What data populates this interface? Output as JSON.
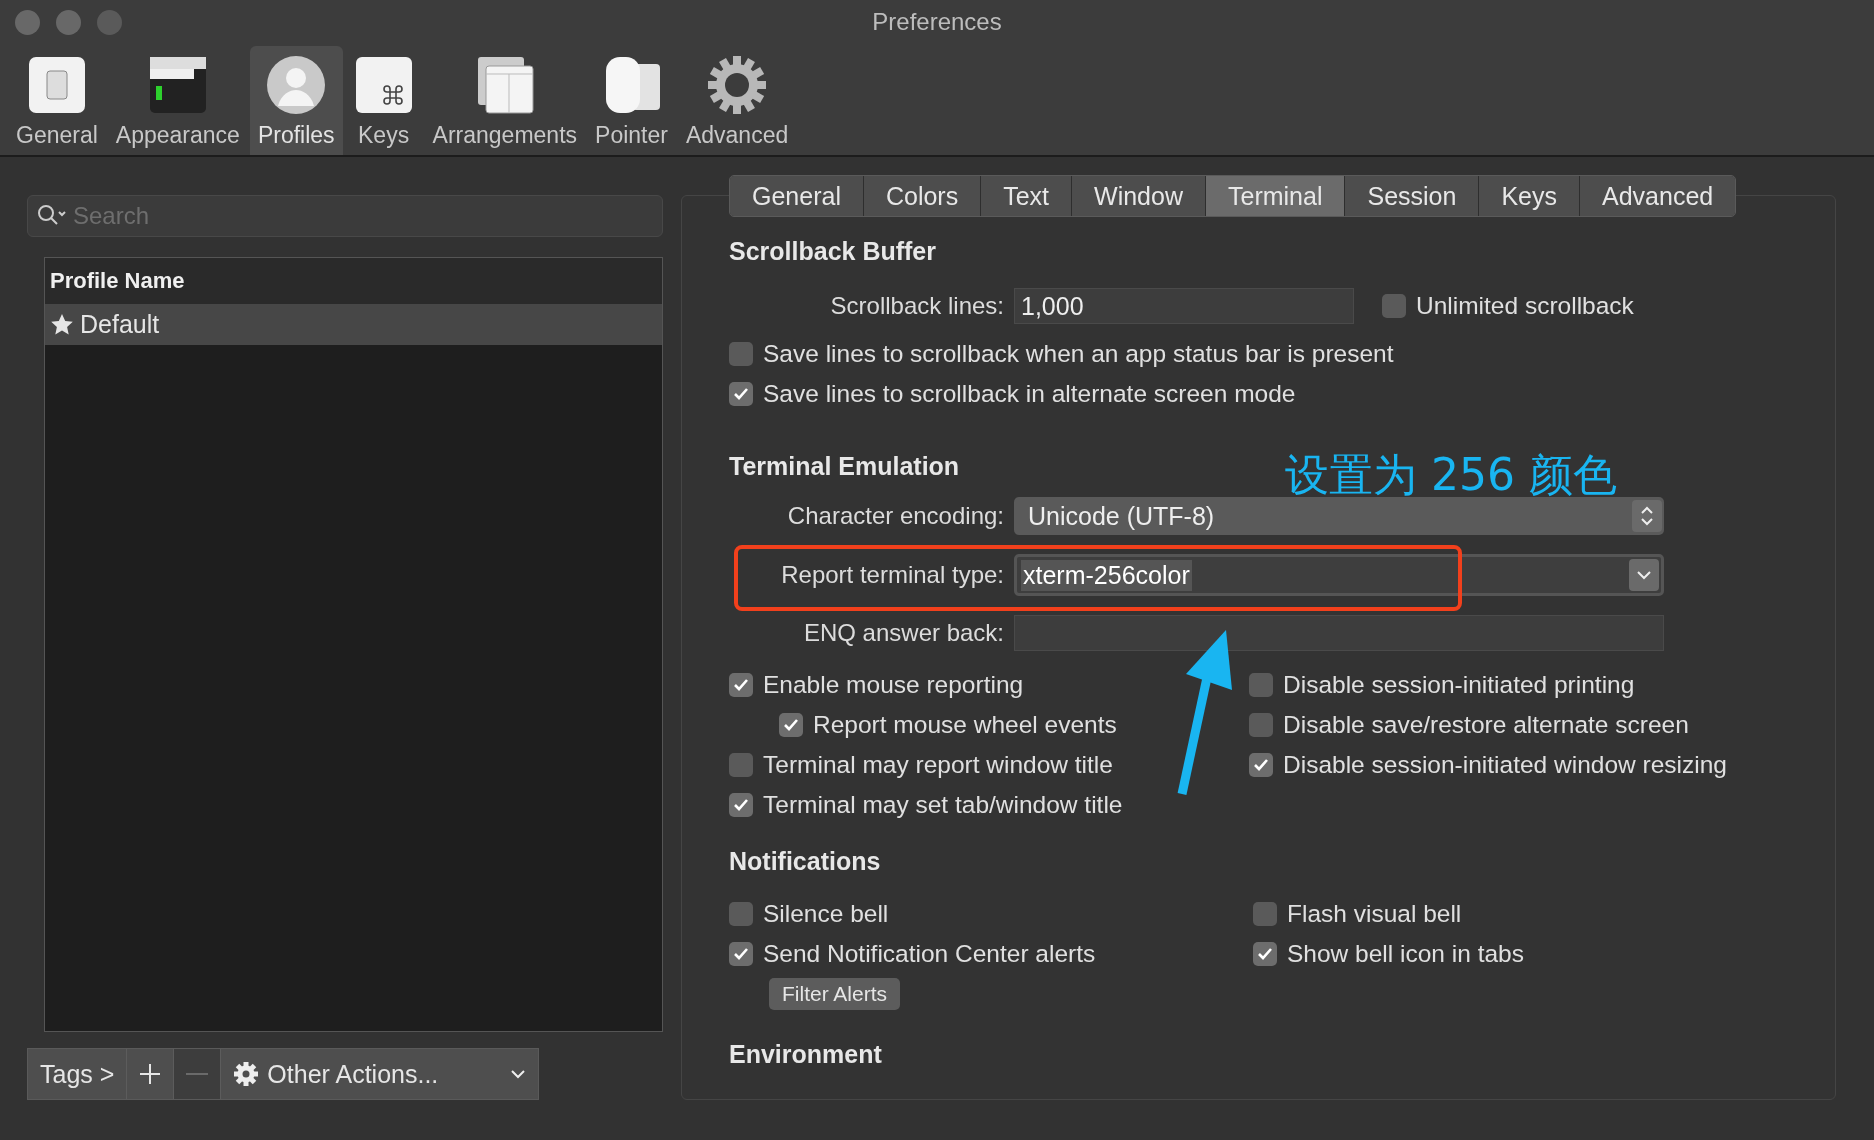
{
  "window": {
    "title": "Preferences"
  },
  "toolbar": [
    {
      "label": "General",
      "selected": false
    },
    {
      "label": "Appearance",
      "selected": false
    },
    {
      "label": "Profiles",
      "selected": true
    },
    {
      "label": "Keys",
      "selected": false
    },
    {
      "label": "Arrangements",
      "selected": false
    },
    {
      "label": "Pointer",
      "selected": false
    },
    {
      "label": "Advanced",
      "selected": false
    }
  ],
  "search": {
    "placeholder": "Search"
  },
  "profiles": {
    "column": "Profile Name",
    "rows": [
      {
        "name": "Default",
        "default": true,
        "selected": true
      }
    ]
  },
  "bottom_buttons": [
    {
      "kind": "text",
      "label": "Tags >"
    },
    {
      "kind": "plus"
    },
    {
      "kind": "minus",
      "disabled": true
    },
    {
      "kind": "menu",
      "label": "Other Actions..."
    }
  ],
  "tabs": [
    {
      "label": "General",
      "selected": false
    },
    {
      "label": "Colors",
      "selected": false
    },
    {
      "label": "Text",
      "selected": false
    },
    {
      "label": "Window",
      "selected": false
    },
    {
      "label": "Terminal",
      "selected": true
    },
    {
      "label": "Session",
      "selected": false
    },
    {
      "label": "Keys",
      "selected": false
    },
    {
      "label": "Advanced",
      "selected": false
    }
  ],
  "scrollback": {
    "heading": "Scrollback Buffer",
    "lines_label": "Scrollback lines:",
    "lines_value": "1,000",
    "unlimited": {
      "label": "Unlimited scrollback",
      "checked": false
    },
    "options": [
      {
        "label": "Save lines to scrollback when an app status bar is present",
        "checked": false
      },
      {
        "label": "Save lines to scrollback in alternate screen mode",
        "checked": true
      }
    ]
  },
  "emulation": {
    "heading": "Terminal Emulation",
    "fields": [
      {
        "kind": "popup",
        "label": "Character encoding:",
        "value": "Unicode (UTF-8)"
      },
      {
        "kind": "combo",
        "label": "Report terminal type:",
        "value": "xterm-256color"
      },
      {
        "kind": "text",
        "label": "ENQ answer back:"
      }
    ],
    "left_options": [
      {
        "label": "Enable mouse reporting",
        "checked": true,
        "children": [
          {
            "label": "Report mouse wheel events",
            "checked": true
          }
        ]
      },
      {
        "label": "Terminal may report window title",
        "checked": false
      },
      {
        "label": "Terminal may set tab/window title",
        "checked": true
      }
    ],
    "right_options": [
      {
        "label": "Disable session-initiated printing",
        "checked": false
      },
      {
        "label": "Disable save/restore alternate screen",
        "checked": false
      },
      {
        "label": "Disable session-initiated window resizing",
        "checked": true
      }
    ]
  },
  "notifications": {
    "heading": "Notifications",
    "left_options": [
      {
        "label": "Silence bell",
        "checked": false
      },
      {
        "label": "Send Notification Center alerts",
        "checked": true
      }
    ],
    "right_options": [
      {
        "label": "Flash visual bell",
        "checked": false
      },
      {
        "label": "Show bell icon in tabs",
        "checked": true
      }
    ],
    "button": "Filter Alerts"
  },
  "environment": {
    "heading": "Environment"
  },
  "annotation": {
    "text": "设置为 256 颜色"
  }
}
